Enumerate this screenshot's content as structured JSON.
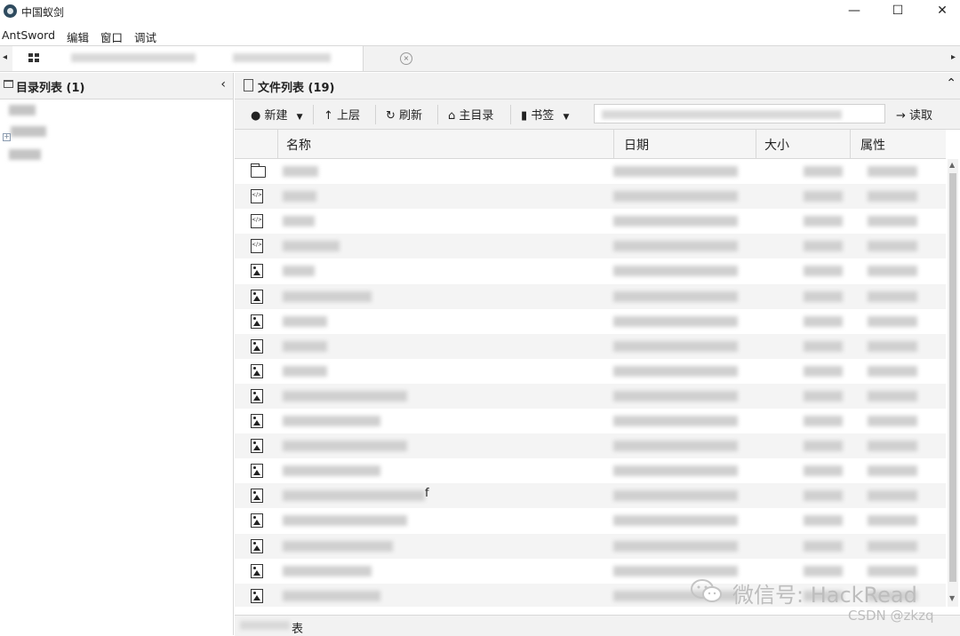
{
  "window": {
    "title": "中国蚁剑",
    "controls": {
      "minimize": "—",
      "maximize": "☐",
      "close": "✕"
    }
  },
  "menu": [
    "AntSword",
    "编辑",
    "窗口",
    "调试"
  ],
  "tabstrip": {
    "left_arrow": "◂",
    "right_arrow": "▸",
    "close_glyph": "×"
  },
  "left_panel": {
    "title": "目录列表 (1)",
    "collapse_glyph": "‹",
    "expander_glyph": "+"
  },
  "right_panel": {
    "title": "文件列表 (19)",
    "collapse_glyph": "⌃",
    "toolbar": {
      "new_label": "新建",
      "up_label": "上层",
      "refresh_label": "刷新",
      "home_label": "主目录",
      "bookmark_label": "书签",
      "path_value": "",
      "read_label": "读取"
    },
    "columns": [
      "名称",
      "日期",
      "大小",
      "属性"
    ],
    "rows": [
      {
        "icon": "folder",
        "name": ""
      },
      {
        "icon": "code",
        "name": ""
      },
      {
        "icon": "code",
        "name": ""
      },
      {
        "icon": "code",
        "name": ""
      },
      {
        "icon": "image",
        "name": ""
      },
      {
        "icon": "image",
        "name": ""
      },
      {
        "icon": "image",
        "name": ""
      },
      {
        "icon": "image",
        "name": ""
      },
      {
        "icon": "image",
        "name": ""
      },
      {
        "icon": "image",
        "name": ""
      },
      {
        "icon": "image",
        "name": ""
      },
      {
        "icon": "image",
        "name": ""
      },
      {
        "icon": "image",
        "name": ""
      },
      {
        "icon": "image",
        "name": "f"
      },
      {
        "icon": "image",
        "name": ""
      },
      {
        "icon": "image",
        "name": ""
      },
      {
        "icon": "image",
        "name": ""
      },
      {
        "icon": "image",
        "name": ""
      }
    ],
    "status_text": "表"
  },
  "watermark": {
    "text": "微信号: HackRead",
    "csdn": "CSDN @zkzq"
  },
  "colors": {
    "panel_bg": "#f2f2f2",
    "row_alt": "#f4f4f4",
    "border": "#d8d8d8"
  }
}
